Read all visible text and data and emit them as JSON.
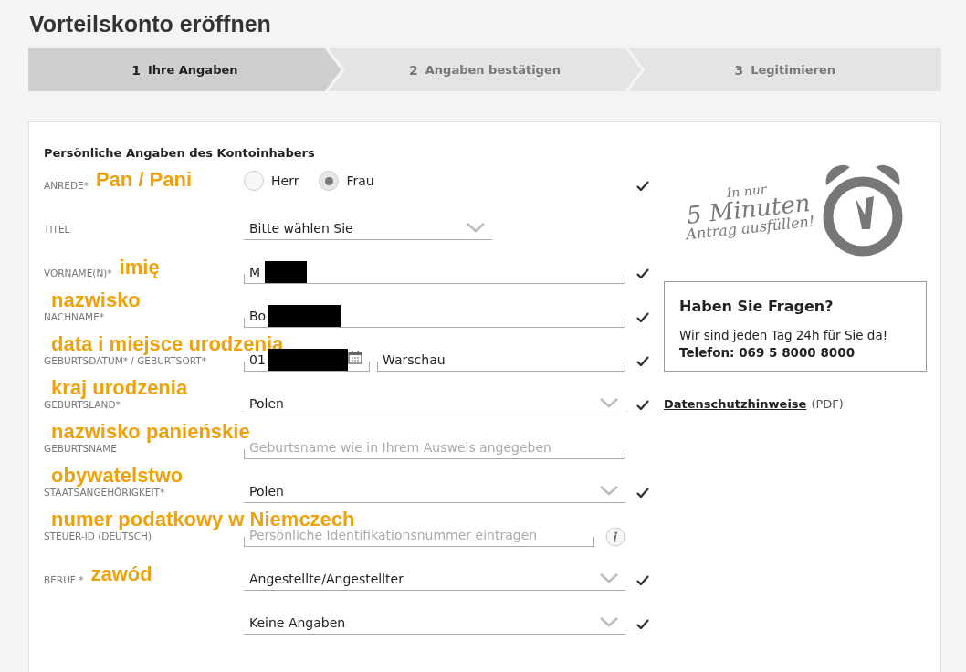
{
  "page_title": "Vorteilskonto eröffnen",
  "steps": [
    {
      "number": "1",
      "label": "Ihre Angaben",
      "selected": true
    },
    {
      "number": "2",
      "label": "Angaben bestätigen",
      "selected": false
    },
    {
      "number": "3",
      "label": "Legitimieren",
      "selected": false
    }
  ],
  "section_title": "Persönliche Angaben des Kontoinhabers",
  "rows": [
    {
      "label": "ANREDE*",
      "annotation": "Pan / Pani",
      "annotation_inline": true,
      "kind": "radio",
      "options": [
        {
          "label": "Herr",
          "selected": false
        },
        {
          "label": "Frau",
          "selected": true
        }
      ],
      "valid": true
    },
    {
      "label": "TITEL",
      "kind": "select",
      "value": "Bitte wählen Sie",
      "short": true,
      "valid": false
    },
    {
      "label": "VORNAME(N)*",
      "annotation": "imię",
      "annotation_inline": true,
      "kind": "text",
      "value": "M",
      "redacted": true,
      "valid": true
    },
    {
      "label": "NACHNAME*",
      "annotation": "nazwisko",
      "annotation_inline": false,
      "kind": "text",
      "value": "Bo",
      "redacted": true,
      "valid": true
    },
    {
      "label": "GEBURTSDATUM* / GEBURTSORT*",
      "annotation": "data i miejsce urodzenia",
      "annotation_inline": false,
      "kind": "date_place",
      "value": "01",
      "redacted": true,
      "place": "Warschau",
      "valid": true
    },
    {
      "label": "GEBURTSLAND*",
      "annotation": "kraj urodzenia",
      "annotation_inline": false,
      "kind": "select",
      "value": "Polen",
      "valid": true
    },
    {
      "label": "GEBURTSNAME",
      "annotation": "nazwisko panieńskie",
      "annotation_inline": false,
      "kind": "text",
      "placeholder": "Geburtsname wie in Ihrem Ausweis angegeben",
      "valid": false
    },
    {
      "label": "STAATSANGEHÖRIGKEIT*",
      "annotation": "obywatelstwo",
      "annotation_inline": false,
      "kind": "select",
      "value": "Polen",
      "valid": true
    },
    {
      "label": "STEUER-ID (DEUTSCH)",
      "annotation": "numer podatkowy w Niemczech",
      "annotation_inline": false,
      "kind": "text_info",
      "placeholder": "Persönliche Identifikationsnummer eintragen",
      "valid": false
    },
    {
      "label": "BERUF *",
      "annotation": "zawód",
      "annotation_inline": true,
      "kind": "select",
      "value": "Angestellte/Angestellter",
      "valid": true
    },
    {
      "kind": "select",
      "value": "Keine Angaben",
      "valid": true
    }
  ],
  "promo": {
    "line_1": "In nur",
    "line_2": "5 Minuten",
    "line_3": "Antrag ausfüllen!"
  },
  "help_box": {
    "title": "Haben Sie Fragen?",
    "text": "Wir sind jeden Tag 24h für Sie da!",
    "phone": "Telefon: 069 5 8000 8000"
  },
  "privacy_link": {
    "label": "Datenschutzhinweise",
    "suffix": "(PDF)"
  }
}
